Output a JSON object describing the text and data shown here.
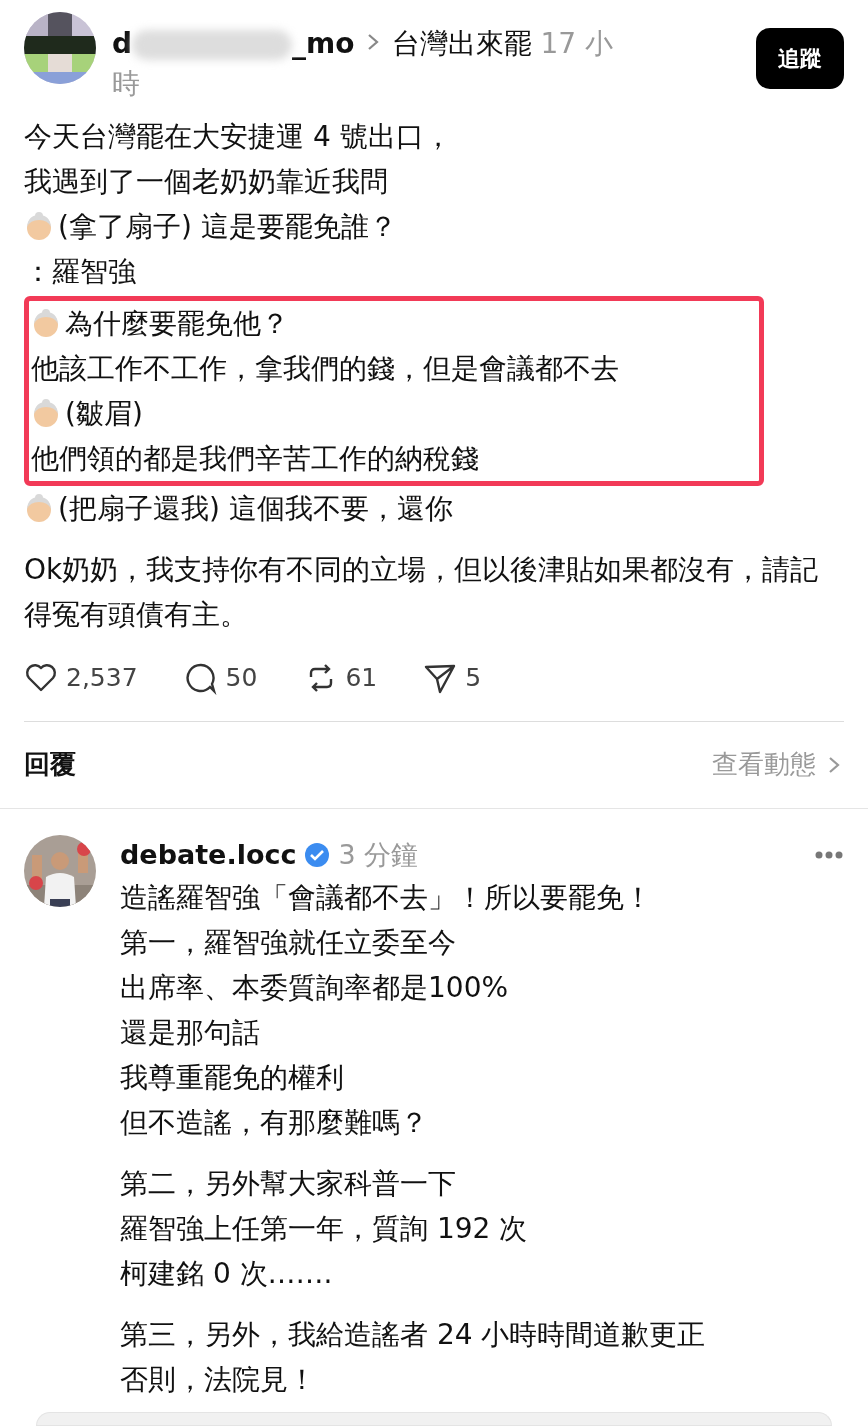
{
  "post": {
    "username_start": "d",
    "username_end": "_mo",
    "community": "台灣出來罷",
    "time_lines": [
      "17 小",
      "時"
    ],
    "follow_button": "追蹤",
    "blocks": [
      {
        "highlighted": false,
        "lines": [
          {
            "kind": "plain",
            "text": "今天台灣罷在大安捷運 4 號出口，"
          },
          {
            "kind": "plain",
            "text": "我遇到了一個老奶奶靠近我問"
          },
          {
            "kind": "grandma",
            "text": "(拿了扇子) 這是要罷免誰？"
          },
          {
            "kind": "plain",
            "text": "：羅智強"
          }
        ]
      },
      {
        "highlighted": true,
        "lines": [
          {
            "kind": "grandma",
            "text": "為什麼要罷免他？"
          },
          {
            "kind": "plain",
            "text": "他該工作不工作，拿我們的錢，但是會議都不去"
          },
          {
            "kind": "grandma",
            "text": "(皺眉)"
          },
          {
            "kind": "plain",
            "text": "他們領的都是我們辛苦工作的納稅錢"
          }
        ]
      },
      {
        "highlighted": false,
        "lines": [
          {
            "kind": "grandma",
            "text": "(把扇子還我) 這個我不要，還你"
          }
        ]
      },
      {
        "highlighted": false,
        "lines": [
          {
            "kind": "plain",
            "text": "Ok奶奶，我支持你有不同的立場，但以後津貼如果都沒有，請記得冤有頭債有主。"
          }
        ]
      }
    ],
    "stats": [
      {
        "kind": "like",
        "count": "2,537"
      },
      {
        "kind": "comment",
        "count": "50"
      },
      {
        "kind": "repost",
        "count": "61"
      },
      {
        "kind": "share",
        "count": "5"
      }
    ]
  },
  "replies_header": {
    "title": "回覆",
    "activity_link": "查看動態"
  },
  "reply": {
    "username": "debate.locc",
    "verified": true,
    "time": "3 分鐘",
    "paragraphs": [
      [
        "造謠羅智強「會議都不去」！所以要罷免！",
        "第一，羅智強就任立委至今",
        "出席率、本委質詢率都是100%",
        "還是那句話",
        "我尊重罷免的權利",
        "但不造謠，有那麼難嗎？"
      ],
      [
        "第二，另外幫大家科普一下",
        "羅智強上任第一年，質詢 192 次",
        "柯建銘 0 次……."
      ],
      [
        "第三，另外，我給造謠者 24 小時時間道歉更正",
        "否則，法院見！"
      ]
    ]
  }
}
